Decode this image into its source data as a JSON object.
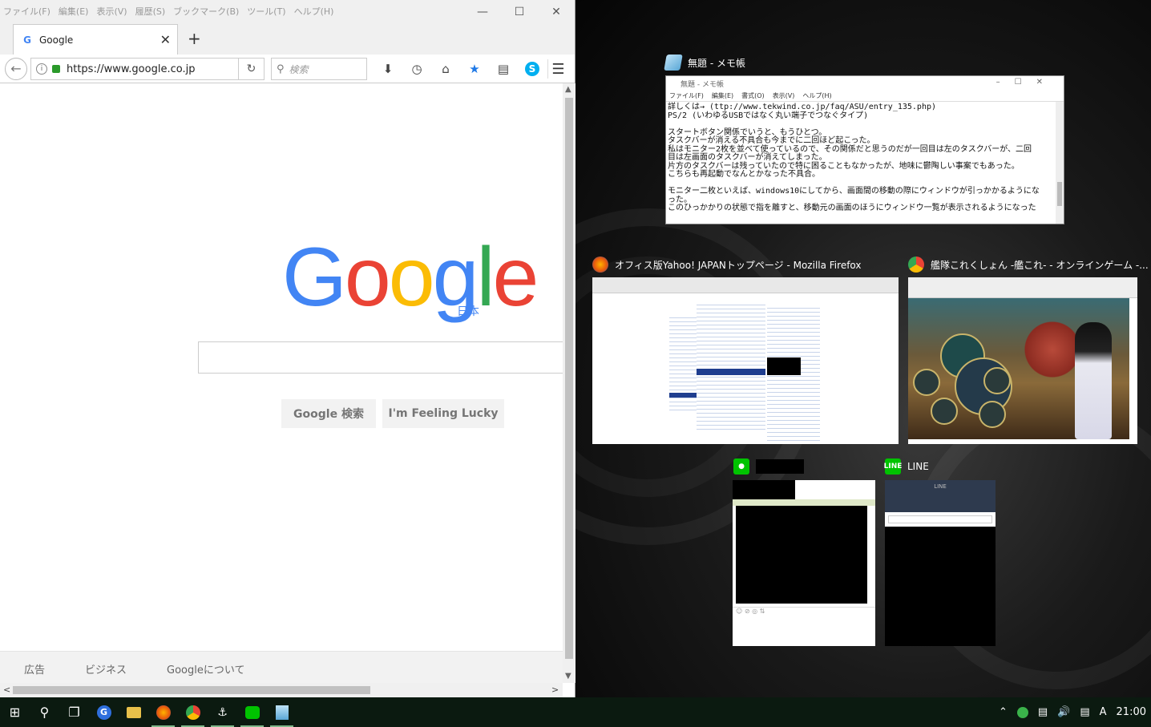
{
  "firefox": {
    "menu": [
      "ファイル(F)",
      "編集(E)",
      "表示(V)",
      "履歴(S)",
      "ブックマーク(B)",
      "ツール(T)",
      "ヘルプ(H)"
    ],
    "tab_title": "Google",
    "url": "https://www.google.co.jp",
    "search_placeholder": "検索",
    "page": {
      "logo_region": "日本",
      "btn_search": "Google 検索",
      "btn_lucky": "I'm Feeling Lucky",
      "footer": [
        "広告",
        "ビジネス",
        "Googleについて"
      ]
    }
  },
  "snap": {
    "notepad": {
      "caption": "無題 - メモ帳",
      "inner_title": "無題 - メモ帳",
      "menu": [
        "ファイル(F)",
        "編集(E)",
        "書式(O)",
        "表示(V)",
        "ヘルプ(H)"
      ],
      "text": "詳しくは→ (ttp://www.tekwind.co.jp/faq/ASU/entry_135.php)\nPS/2 (いわゆるUSBではなく丸い端子でつなぐタイプ)\n\nスタートボタン関係でいうと、もうひとつ。\nタスクバーが消える不具合も今までに二回ほど起こった。\n私はモニター2枚を並べて使っているので、その関係だと思うのだが一回目は左のタスクバーが、二回\n目は左画面のタスクバーが消えてしまった。\n片方のタスクバーは残っていたので特に困ることもなかったが、地味に鬱陶しい事案でもあった。\nこちらも再起動でなんとかなった不具合。\n\nモニター二枚といえば、windows10にしてから、画面間の移動の際にウィンドウが引っかかるようにな\nった。\nこのひっかかりの状態で指を離すと、移動元の画面のほうにウィンドウ一覧が表示されるようになった"
    },
    "firefox_yahoo": {
      "caption": "オフィス版Yahoo! JAPANトップページ - Mozilla Firefox"
    },
    "chrome_kancolle": {
      "caption": "艦隊これくしょん -艦これ- - オンラインゲーム -..."
    },
    "line2": {
      "caption": "LINE",
      "inner_title": "LINE"
    }
  },
  "taskbar": {
    "clock": "21:00",
    "ime": "A"
  },
  "colors": {
    "google_blue": "#4285F4",
    "google_red": "#EA4335",
    "google_yellow": "#FBBC05",
    "google_green": "#34A853",
    "line_green": "#00C300"
  }
}
